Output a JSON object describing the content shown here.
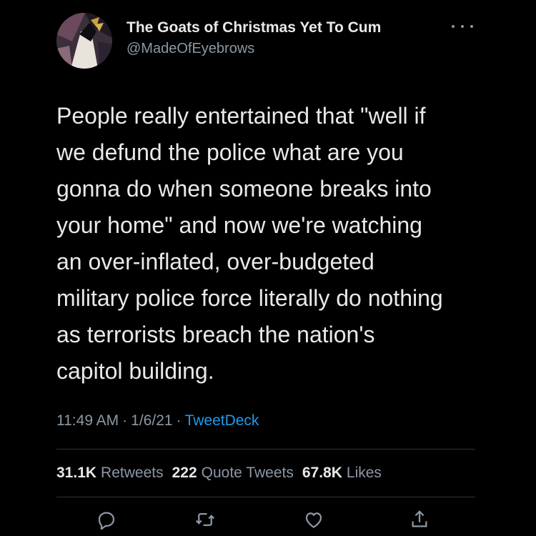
{
  "author": {
    "display_name": "The Goats of Christmas Yet To Cum",
    "handle": "@MadeOfEyebrows",
    "avatar_icon": "avatar-illustration"
  },
  "tweet": {
    "text": "People really entertained that \"well if\nwe defund the police what are you\ngonna do when someone breaks into\nyour home\" and now we're watching\nan over-inflated, over-budgeted\nmilitary police force literally do nothing\nas terrorists breach the nation's\ncapitol building.",
    "time": "11:49 AM",
    "date": "1/6/21",
    "separator": "·",
    "source": "TweetDeck"
  },
  "stats": {
    "retweets_count": "31.1K",
    "retweets_label": "Retweets",
    "quote_count": "222",
    "quote_label": "Quote Tweets",
    "likes_count": "67.8K",
    "likes_label": "Likes"
  },
  "actions": [
    "reply-icon",
    "retweet-icon",
    "like-icon",
    "share-icon"
  ],
  "colors": {
    "background": "#000000",
    "text": "#e7e9ea",
    "secondary": "#8b98a5",
    "accent": "#1d9bf0",
    "divider": "#2f3336"
  }
}
